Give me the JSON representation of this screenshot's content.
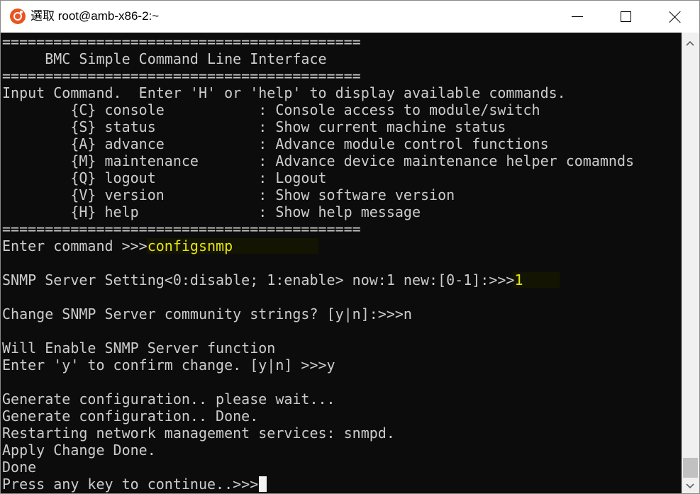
{
  "window": {
    "title": "選取 root@amb-x86-2:~",
    "buttons": {
      "minimize": "minimize",
      "maximize": "maximize",
      "close": "close"
    }
  },
  "terminal": {
    "lines": [
      "==========================================",
      "     BMC Simple Command Line Interface",
      "==========================================",
      "Input Command.  Enter 'H' or 'help' to display available commands.",
      "        {C} console           : Console access to module/switch",
      "        {S} status            : Show current machine status",
      "        {A} advance           : Advance module control functions",
      "        {M} maintenance       : Advance device maintenance helper comamnds",
      "        {Q} logout            : Logout",
      "        {V} version           : Show software version",
      "        {H} help              : Show help message",
      "==========================================",
      "Enter command >>>",
      "",
      "SNMP Server Setting<0:disable; 1:enable> now:1 new:[0-1]:>>>",
      "",
      "Change SNMP Server community strings? [y|n]:>>>n",
      "",
      "Will Enable SNMP Server function",
      "Enter 'y' to confirm change. [y|n] >>>y",
      "",
      "Generate configuration.. please wait...",
      "Generate configuration.. Done.",
      "Restarting network management services: snmpd.",
      "Apply Change Done.",
      "Done",
      "Press any key to continue..>>>"
    ],
    "input_command": "configsnmp",
    "input_snmp_setting": "1"
  },
  "colors": {
    "background": "#0c0c0c",
    "foreground": "#cccccc",
    "input_yellow": "#e5e510",
    "ubuntu_orange": "#e95420"
  }
}
